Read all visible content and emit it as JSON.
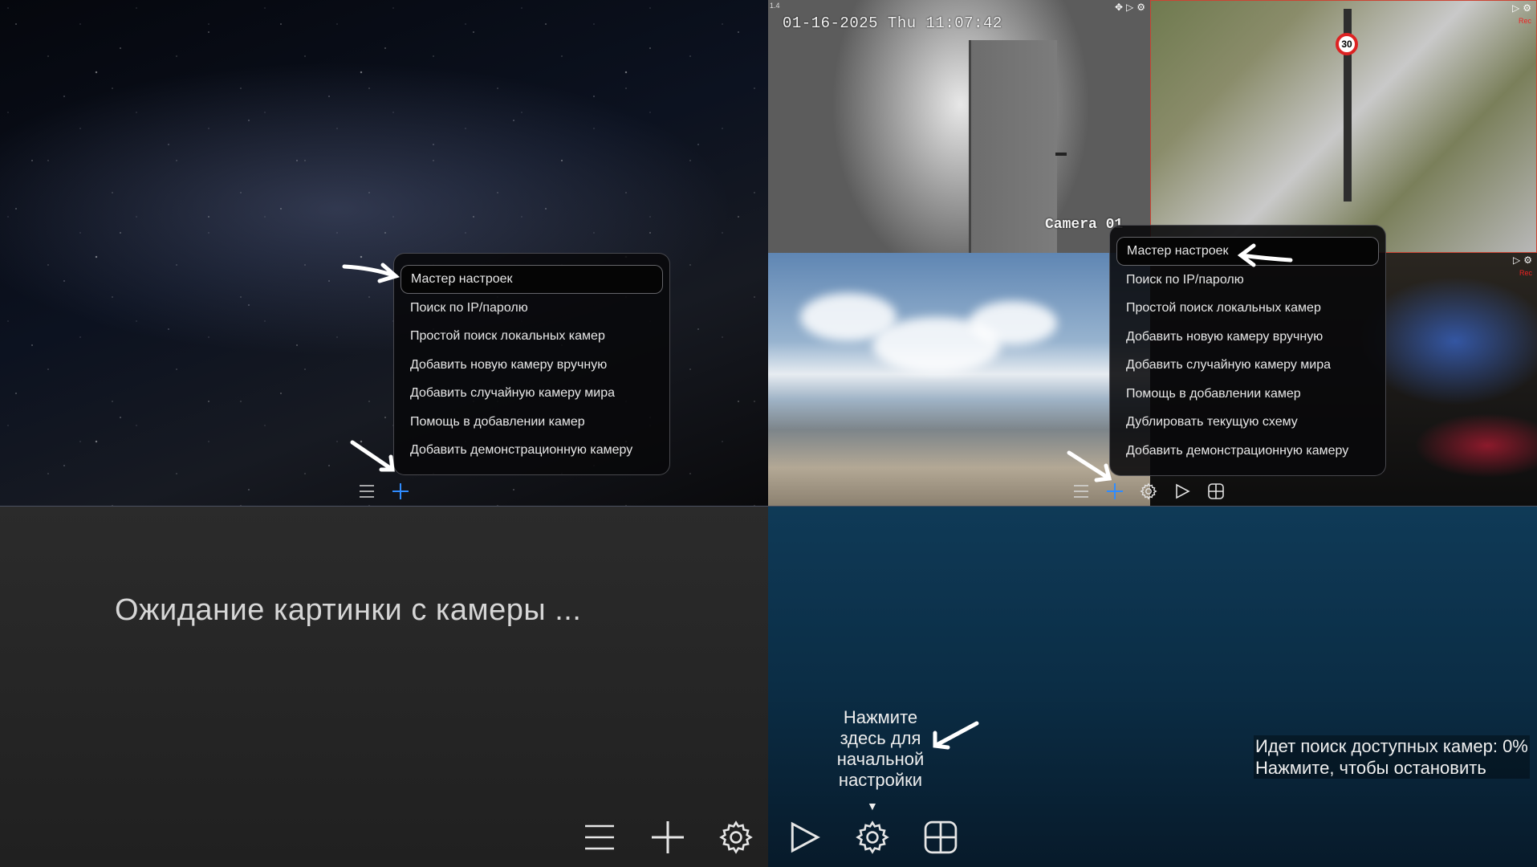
{
  "setup_menu_items": [
    "Мастер настроек",
    "Поиск по IP/паролю",
    "Простой поиск локальных камер",
    "Добавить новую камеру вручную",
    "Добавить случайную камеру мира",
    "Помощь в добавлении камер",
    "Добавить демонстрационную камеру"
  ],
  "cameras_menu_items": [
    "Мастер настроек",
    "Поиск по IP/паролю",
    "Простой поиск локальных камер",
    "Добавить новую камеру вручную",
    "Добавить случайную камеру мира",
    "Помощь в добавлении камер",
    "Дублировать текущую схему",
    "Добавить демонстрационную камеру"
  ],
  "camera_osd": {
    "timestamp": "01-16-2025 Thu 11:07:42",
    "name": "Camera 01",
    "tag": "1.4",
    "traffic_sign": "30",
    "rec_label": "Rec"
  },
  "waiting_text": "Ожидание картинки с камеры ...",
  "hint": {
    "lines": [
      "Нажмите",
      "здесь для",
      "начальной",
      "настройки"
    ],
    "caret": "▼"
  },
  "search_status": {
    "line1": "Идет поиск доступных камер: 0%",
    "line2": "Нажмите, чтобы остановить"
  },
  "toolbar_small_1": [
    "menu-icon",
    "add-icon"
  ],
  "toolbar_small_2": [
    "menu-icon",
    "add-icon",
    "gear-icon",
    "play-icon",
    "layout-grid-icon"
  ],
  "toolbar_big": [
    "menu-icon",
    "add-icon",
    "gear-icon",
    "play-icon",
    "gear-icon",
    "layout-grid-icon"
  ],
  "colors": {
    "accent_add": "#2f8cff",
    "icon": "#e6e6e6",
    "menu_bg": "#08080a"
  }
}
